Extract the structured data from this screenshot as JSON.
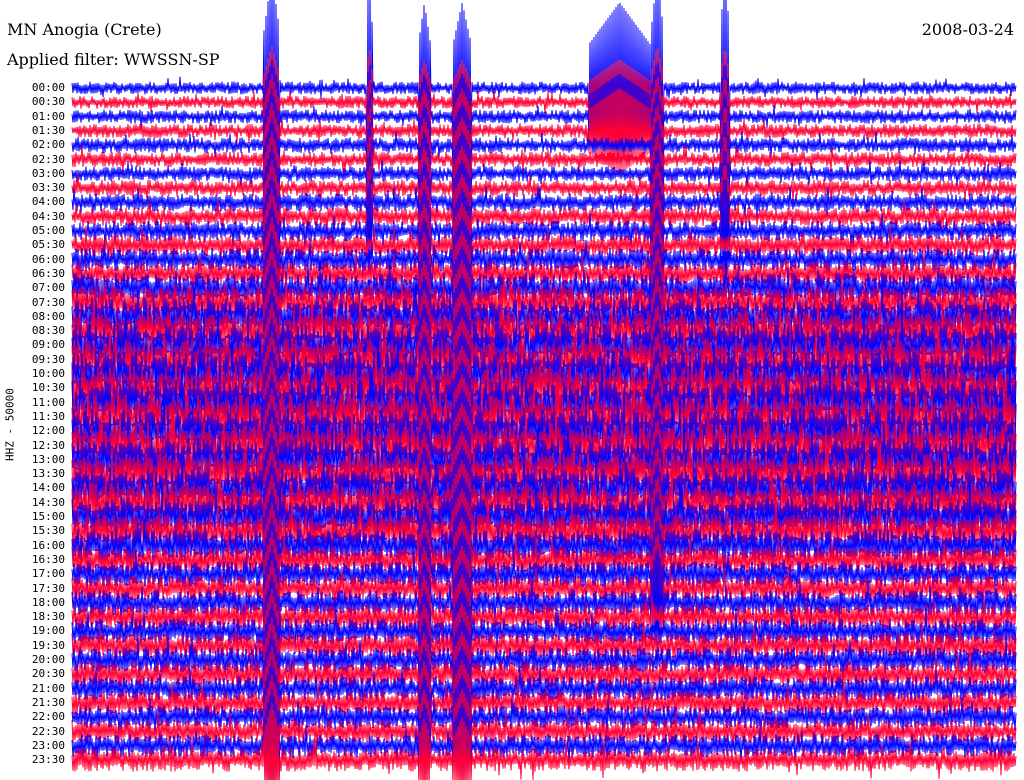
{
  "header": {
    "title": "MN Anogia (Crete)",
    "filter": "Applied filter: WWSSN-SP",
    "date": "2008-03-24"
  },
  "chart_data": {
    "type": "line",
    "title": "MN Anogia (Crete)",
    "subtitle": "Applied filter: WWSSN-SP",
    "date": "2008-03-24",
    "ylabel": "HHZ - 50000",
    "x_range_minutes": [
      0,
      30
    ],
    "tick_labels": [
      "00:00",
      "00:30",
      "01:00",
      "01:30",
      "02:00",
      "02:30",
      "03:00",
      "03:30",
      "04:00",
      "04:30",
      "05:00",
      "05:30",
      "06:00",
      "06:30",
      "07:00",
      "07:30",
      "08:00",
      "08:30",
      "09:00",
      "09:30",
      "10:00",
      "10:30",
      "11:00",
      "11:30",
      "12:00",
      "12:30",
      "13:00",
      "13:30",
      "14:00",
      "14:30",
      "15:00",
      "15:30",
      "16:00",
      "16:30",
      "17:00",
      "17:30",
      "18:00",
      "18:30",
      "19:00",
      "19:30",
      "20:00",
      "20:30",
      "21:00",
      "21:30",
      "22:00",
      "22:30",
      "23:00",
      "23:30"
    ],
    "series_colors": [
      "#0000ff",
      "#ff0033"
    ],
    "relative_noise_amplitude": [
      0.5,
      0.5,
      0.55,
      0.55,
      0.6,
      0.6,
      0.6,
      0.65,
      0.7,
      0.75,
      0.8,
      0.85,
      0.9,
      0.95,
      1.2,
      1.4,
      1.5,
      1.6,
      1.7,
      1.7,
      1.8,
      1.8,
      1.8,
      1.8,
      1.8,
      1.8,
      1.7,
      1.7,
      1.6,
      1.6,
      1.5,
      1.4,
      1.3,
      1.1,
      1.0,
      1.0,
      1.0,
      1.0,
      1.0,
      1.0,
      1.0,
      1.0,
      0.95,
      0.95,
      0.9,
      0.9,
      0.9,
      0.9
    ],
    "events": [
      {
        "trace_from": 0,
        "trace_to": 47,
        "minute": 6.35,
        "width_min": 0.25,
        "amp": 4
      },
      {
        "trace_from": 0,
        "trace_to": 10,
        "minute": 9.45,
        "width_min": 0.1,
        "amp": 4
      },
      {
        "trace_from": 0,
        "trace_to": 47,
        "minute": 11.2,
        "width_min": 0.2,
        "amp": 3
      },
      {
        "trace_from": 0,
        "trace_to": 47,
        "minute": 12.4,
        "width_min": 0.3,
        "amp": 3
      },
      {
        "trace_from": 0,
        "trace_to": 3,
        "minute": 17.4,
        "width_min": 1.0,
        "amp": 3
      },
      {
        "trace_from": 0,
        "trace_to": 36,
        "minute": 18.6,
        "width_min": 0.2,
        "amp": 4
      },
      {
        "trace_from": 0,
        "trace_to": 10,
        "minute": 20.75,
        "width_min": 0.15,
        "amp": 4
      }
    ]
  }
}
